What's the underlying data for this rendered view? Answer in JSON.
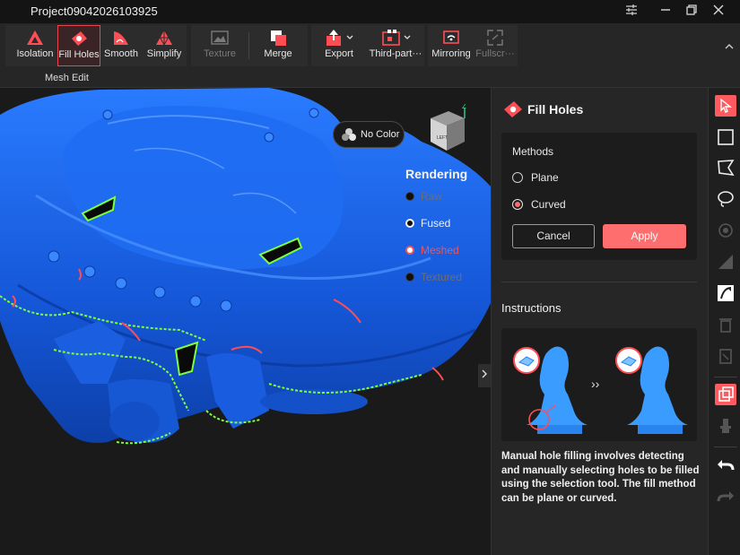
{
  "window": {
    "title": "Project09042026103925",
    "controls": [
      "settings-icon",
      "minimize-icon",
      "restore-icon",
      "close-icon"
    ]
  },
  "toolbar": {
    "group_label": "Mesh Edit",
    "buttons": [
      {
        "label": "Isolation",
        "icon": "isolation-icon"
      },
      {
        "label": "Fill Holes",
        "icon": "fill-holes-icon",
        "active": true
      },
      {
        "label": "Smooth",
        "icon": "smooth-icon"
      },
      {
        "label": "Simplify",
        "icon": "simplify-icon"
      },
      {
        "label": "Texture",
        "icon": "texture-icon",
        "disabled": true
      },
      {
        "label": "Merge",
        "icon": "merge-icon"
      },
      {
        "label": "Export",
        "icon": "export-icon"
      },
      {
        "label": "Third-part···",
        "icon": "third-party-icon"
      },
      {
        "label": "Mirroring",
        "icon": "mirroring-icon"
      },
      {
        "label": "Fullscr···",
        "icon": "fullscreen-icon",
        "disabled": true
      }
    ]
  },
  "viewport": {
    "color_toggle": "No Color",
    "rendering": {
      "title": "Rendering",
      "options": [
        {
          "label": "Raw",
          "state": "disabled"
        },
        {
          "label": "Fused",
          "state": "enabled"
        },
        {
          "label": "Meshed",
          "state": "selected"
        },
        {
          "label": "Textured",
          "state": "disabled"
        }
      ]
    },
    "viewcube": {
      "face_label": "LEFT",
      "axis_label": "Z"
    }
  },
  "panel": {
    "title": "Fill Holes",
    "methods_label": "Methods",
    "methods": [
      {
        "label": "Plane",
        "selected": false
      },
      {
        "label": "Curved",
        "selected": true
      }
    ],
    "cancel_label": "Cancel",
    "apply_label": "Apply",
    "instructions_title": "Instructions",
    "instructions_text": "Manual hole filling involves detecting and manually selecting holes to be filled using the selection tool. The fill method can be plane or curved."
  },
  "right_toolbar": [
    "select-cursor-icon",
    "rectangle-select-icon",
    "polygon-select-icon",
    "lasso-select-icon",
    "connected-select-icon",
    "gradient-icon",
    "invert-selection-icon",
    "delete-icon",
    "clear-icon",
    "duplicate-icon",
    "pin-icon",
    "undo-icon",
    "redo-icon"
  ],
  "colors": {
    "accent": "#ff5a5f",
    "mesh": "#1e6cff",
    "hole_border": "#7dff3c"
  }
}
